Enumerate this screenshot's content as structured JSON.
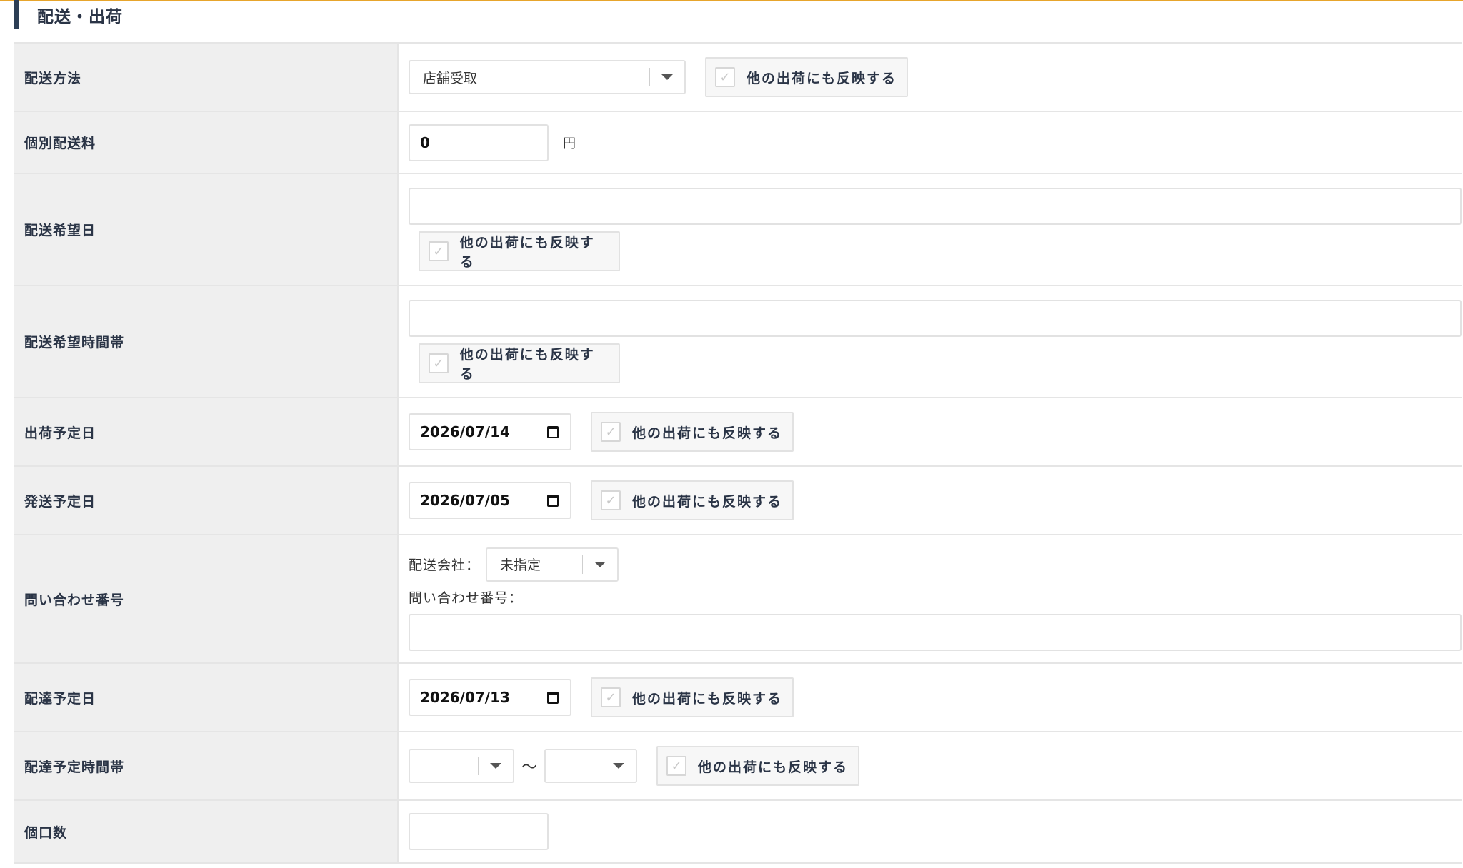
{
  "section": {
    "title": "配送・出荷"
  },
  "rows": {
    "delivery_method": {
      "label": "配送方法",
      "select_value": "店舗受取",
      "reflect_label": "他の出荷にも反映する"
    },
    "shipping_fee": {
      "label": "個別配送料",
      "value": "0",
      "unit": "円"
    },
    "delivery_date": {
      "label": "配送希望日",
      "value": "",
      "reflect_label": "他の出荷にも反映する"
    },
    "delivery_timeslot": {
      "label": "配送希望時間帯",
      "value": "",
      "reflect_label": "他の出荷にも反映する"
    },
    "ship_date": {
      "label": "出荷予定日",
      "value": "2026/07/14",
      "reflect_label": "他の出荷にも反映する"
    },
    "dispatch_date": {
      "label": "発送予定日",
      "value": "2026/07/05",
      "reflect_label": "他の出荷にも反映する"
    },
    "tracking": {
      "label": "問い合わせ番号",
      "carrier_label": "配送会社：",
      "carrier_value": "未指定",
      "tracking_label": "問い合わせ番号：",
      "tracking_value": ""
    },
    "arrival_date": {
      "label": "配達予定日",
      "value": "2026/07/13",
      "reflect_label": "他の出荷にも反映する"
    },
    "arrival_timeslot": {
      "label": "配達予定時間帯",
      "from_value": "",
      "separator": "〜",
      "to_value": "",
      "reflect_label": "他の出荷にも反映する"
    },
    "package_count": {
      "label": "個口数",
      "value": ""
    }
  },
  "colors": {
    "accent_rule": "#e7a52c",
    "label_bg": "#efefef",
    "label_text": "#2a3446"
  }
}
